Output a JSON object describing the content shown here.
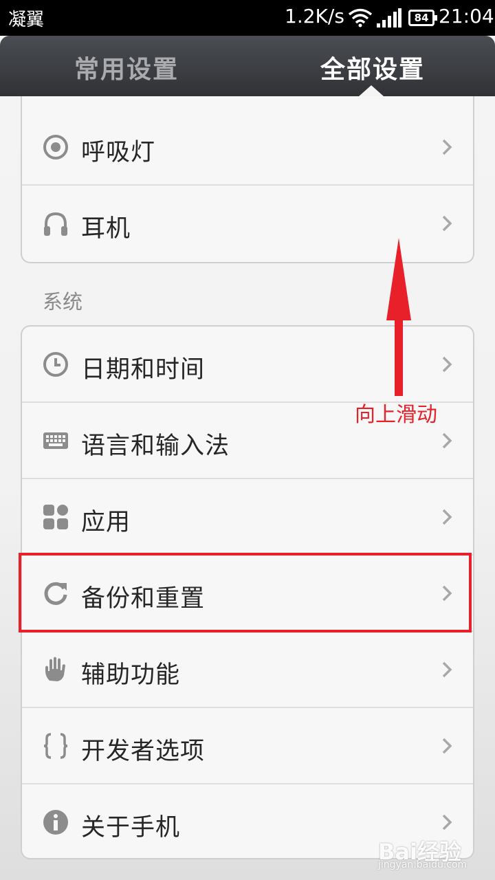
{
  "status_bar": {
    "carrier": "凝翼",
    "net_speed": "1.2K/s",
    "battery": "84",
    "time": "21:04"
  },
  "tabs": {
    "common": "常用设置",
    "all": "全部设置",
    "selected": "全部设置"
  },
  "top_card": {
    "items": [
      {
        "label": "呼吸灯",
        "icon": "breathing-light-icon"
      },
      {
        "label": "耳机",
        "icon": "headphones-icon"
      }
    ]
  },
  "system_section": {
    "title": "系统",
    "items": [
      {
        "label": "日期和时间",
        "icon": "clock-icon"
      },
      {
        "label": "语言和输入法",
        "icon": "keyboard-icon"
      },
      {
        "label": "应用",
        "icon": "apps-icon"
      },
      {
        "label": "备份和重置",
        "icon": "backup-reset-icon"
      },
      {
        "label": "辅助功能",
        "icon": "hand-icon"
      },
      {
        "label": "开发者选项",
        "icon": "braces-icon"
      },
      {
        "label": "关于手机",
        "icon": "info-icon"
      }
    ]
  },
  "annotation": {
    "swipe_label": "向上滑动",
    "highlighted_item": "备份和重置"
  },
  "colors": {
    "annotation_red": "#e8202a",
    "icon_gray": "#8c8c8c",
    "header_dark": "#3a3c40"
  },
  "watermark": {
    "brand": "Bai经验",
    "url": "jingyan.baidu.com"
  }
}
